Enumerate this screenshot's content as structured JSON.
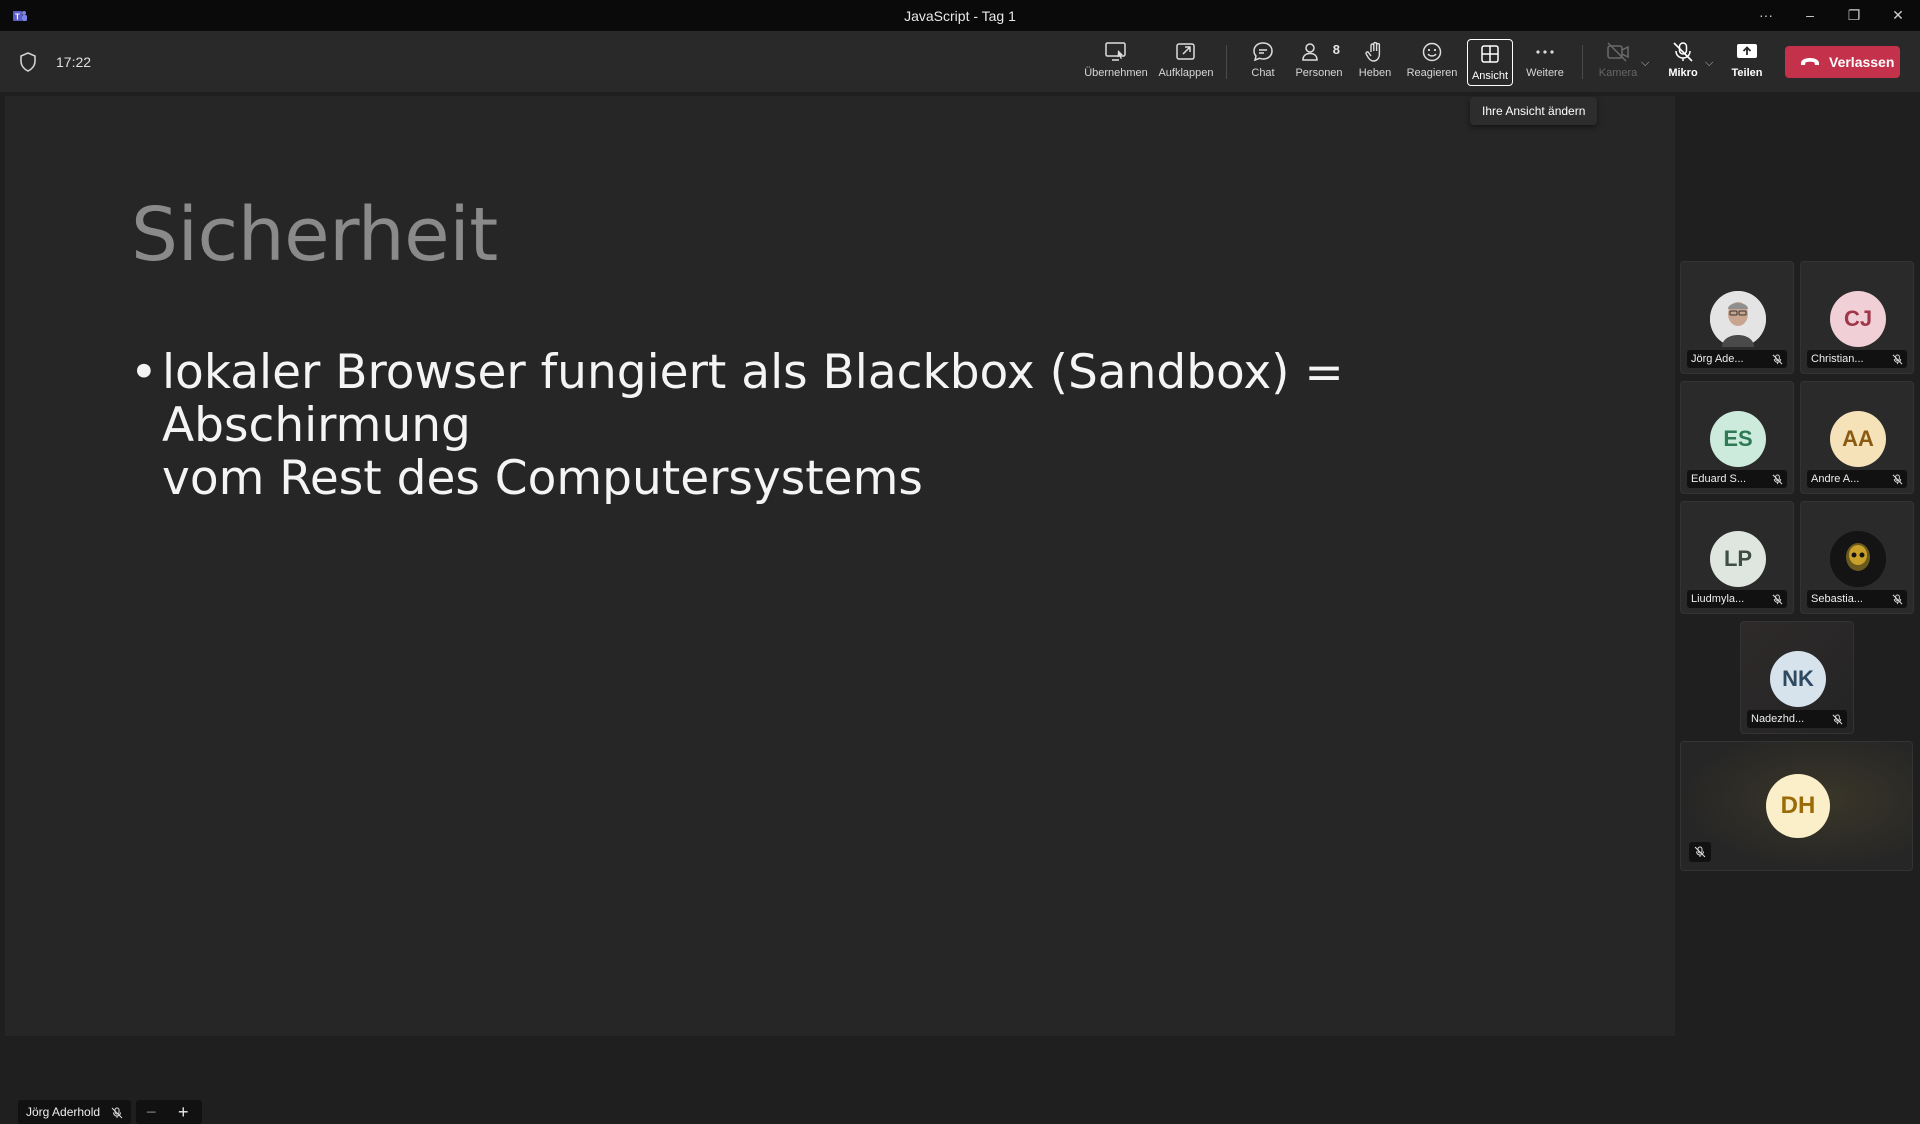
{
  "window": {
    "title": "JavaScript - Tag 1"
  },
  "toolbar": {
    "time": "17:22",
    "buttons": {
      "uebernehmen": "Übernehmen",
      "aufklappen": "Aufklappen",
      "chat": "Chat",
      "personen": "Personen",
      "personen_count": "8",
      "heben": "Heben",
      "reagieren": "Reagieren",
      "ansicht": "Ansicht",
      "weitere": "Weitere",
      "kamera": "Kamera",
      "mikro": "Mikro",
      "teilen": "Teilen",
      "verlassen": "Verlassen"
    },
    "tooltip": "Ihre Ansicht ändern",
    "colors": {
      "leave": "#c4314b"
    }
  },
  "slide": {
    "title": "Sicherheit",
    "bullet_line1": "lokaler Browser fungiert als Blackbox (Sandbox) = Abschirmung",
    "bullet_line2": "vom Rest des Computersystems"
  },
  "presenter": {
    "name": "Jörg Aderhold"
  },
  "participants": [
    {
      "name": "Jörg Ade...",
      "initials": "",
      "photo": true,
      "avatar_bg": "#dcdcdc",
      "avatar_fg": "#333333"
    },
    {
      "name": "Christian...",
      "initials": "CJ",
      "avatar_bg": "#f1cfd6",
      "avatar_fg": "#a0364a"
    },
    {
      "name": "Eduard S...",
      "initials": "ES",
      "avatar_bg": "#cdebdc",
      "avatar_fg": "#2e7a55"
    },
    {
      "name": "Andre A...",
      "initials": "AA",
      "avatar_bg": "#f6e2b8",
      "avatar_fg": "#8a5a12"
    },
    {
      "name": "Liudmyla...",
      "initials": "LP",
      "avatar_bg": "#dfe6df",
      "avatar_fg": "#3f4e44"
    },
    {
      "name": "Sebastia...",
      "initials": "",
      "photo": true,
      "avatar_bg": "#1a1a1a",
      "avatar_fg": "#c9a12a"
    },
    {
      "name": "Nadezhd...",
      "initials": "NK",
      "avatar_bg": "#d7e3ec",
      "avatar_fg": "#2f4a60"
    }
  ],
  "big_participant": {
    "initials": "DH",
    "avatar_bg": "#fbefc9",
    "avatar_fg": "#9a6b06"
  }
}
